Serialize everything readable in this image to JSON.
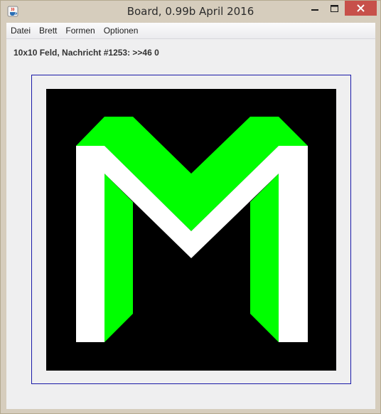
{
  "window": {
    "title": "Board, 0.99b April 2016"
  },
  "menu": {
    "items": [
      "Datei",
      "Brett",
      "Formen",
      "Optionen"
    ]
  },
  "status": {
    "text": "10x10 Feld, Nachricht #1253: >>46 0"
  },
  "board": {
    "background_color": "#000000",
    "shape_color": "#ffffff",
    "shadow_color": "#00ff00",
    "border_color": "#1a1aa8",
    "shape": "M"
  },
  "icons": {
    "app": "java-cup-icon",
    "minimize": "minimize-icon",
    "maximize": "maximize-icon",
    "close": "close-icon"
  }
}
